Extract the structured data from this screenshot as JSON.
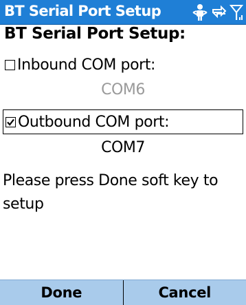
{
  "titlebar": {
    "title": "BT Serial Port Setup",
    "icons": [
      "bluetooth-person-icon",
      "connectivity-icon",
      "signal-icon"
    ],
    "background": "#1f7fd6"
  },
  "main": {
    "heading": "BT Serial Port Setup:",
    "inbound": {
      "label": "Inbound COM port:",
      "checked": false,
      "value": "COM6"
    },
    "outbound": {
      "label": "Outbound COM port:",
      "checked": true,
      "value": "COM7"
    },
    "message": "Please press Done soft key to setup"
  },
  "softkeys": {
    "left": "Done",
    "right": "Cancel",
    "background": "#a9cbeb"
  }
}
